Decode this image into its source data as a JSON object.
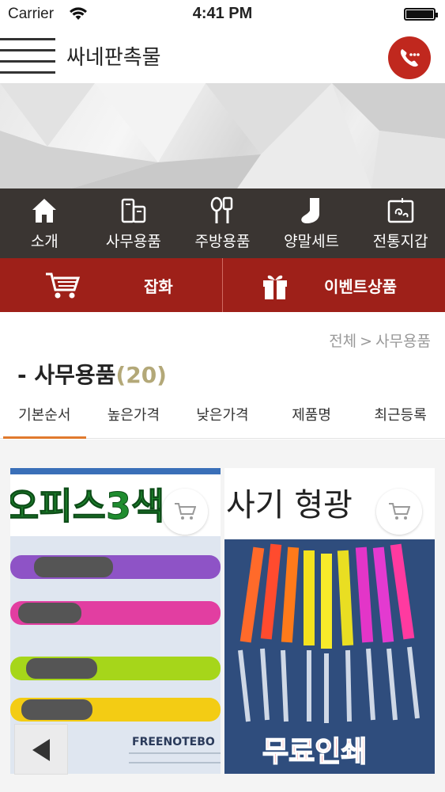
{
  "status_bar": {
    "carrier": "Carrier",
    "time": "4:41 PM"
  },
  "header": {
    "title": "싸네판촉물"
  },
  "categories": [
    {
      "label": "소개",
      "icon": "home-icon"
    },
    {
      "label": "사무용품",
      "icon": "office-supplies-icon"
    },
    {
      "label": "주방용품",
      "icon": "kitchen-utensils-icon"
    },
    {
      "label": "양말세트",
      "icon": "sock-icon"
    },
    {
      "label": "전통지갑",
      "icon": "traditional-wallet-icon"
    }
  ],
  "sub_categories": [
    {
      "label": "잡화",
      "icon": "cart-icon"
    },
    {
      "label": "이벤트상품",
      "icon": "gift-icon"
    }
  ],
  "breadcrumb": {
    "root": "전체",
    "separator": ">",
    "current": "사무용품"
  },
  "section": {
    "title": "- 사무용품",
    "count": "(20)"
  },
  "sort_tabs": [
    {
      "label": "기본순서",
      "active": true
    },
    {
      "label": "높은가격",
      "active": false
    },
    {
      "label": "낮은가격",
      "active": false
    },
    {
      "label": "제품명",
      "active": false
    },
    {
      "label": "최근등록",
      "active": false
    }
  ],
  "products": [
    {
      "image_text_top": "오피스3색",
      "image_text_bottom": "FREENOTEBO"
    },
    {
      "image_text_top": "사기 형광",
      "image_text_bottom": "무료인쇄"
    }
  ],
  "colors": {
    "category_bar": "#3a3532",
    "sub_category_bar": "#9e2019",
    "call_button": "#c0281e",
    "active_tab_underline": "#e07a2e",
    "count_color": "#b3a878"
  }
}
